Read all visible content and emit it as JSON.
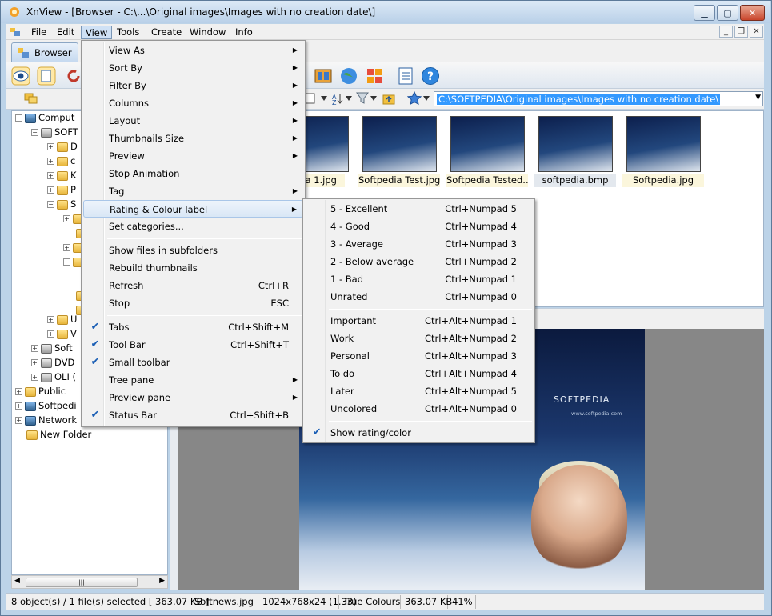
{
  "window": {
    "title": "XnView - [Browser - C:\\...\\Original images\\Images with no creation date\\]"
  },
  "menubar": [
    "File",
    "Edit",
    "View",
    "Tools",
    "Create",
    "Window",
    "Info"
  ],
  "tabs": {
    "browser": "Browser"
  },
  "address": {
    "path": "C:\\SOFTPEDIA\\Original images\\Images with no creation date\\"
  },
  "tree": [
    "Comput",
    "SOFT",
    "D",
    "c",
    "K",
    "P",
    "S",
    "U",
    "V",
    "Soft",
    "DVD",
    "OLI (",
    "Public",
    "Softpedi",
    "Network",
    "New Folder"
  ],
  "thumbnails": [
    "dia 1.jpg",
    "Softpedia Test.jpg",
    "Softpedia Tested....",
    "softpedia.bmp",
    "Softpedia.jpg"
  ],
  "poster": {
    "logo": "SOFTPEDIA",
    "url": "www.softpedia.com"
  },
  "view_menu": {
    "items": [
      {
        "label": "View As",
        "submenu": true
      },
      {
        "label": "Sort By",
        "submenu": true
      },
      {
        "label": "Filter By",
        "submenu": true
      },
      {
        "label": "Columns",
        "submenu": true
      },
      {
        "label": "Layout",
        "submenu": true
      },
      {
        "label": "Thumbnails Size",
        "submenu": true
      },
      {
        "label": "Preview",
        "submenu": true
      },
      {
        "label": "Stop Animation"
      },
      {
        "label": "Tag",
        "submenu": true
      },
      {
        "label": "Rating & Colour label",
        "submenu": true,
        "highlighted": true
      },
      {
        "label": "Set categories..."
      },
      {
        "label": "Show files in subfolders"
      },
      {
        "label": "Rebuild thumbnails"
      },
      {
        "label": "Refresh",
        "shortcut": "Ctrl+R"
      },
      {
        "label": "Stop",
        "shortcut": "ESC"
      },
      {
        "label": "Tabs",
        "shortcut": "Ctrl+Shift+M",
        "checked": true
      },
      {
        "label": "Tool Bar",
        "shortcut": "Ctrl+Shift+T",
        "checked": true
      },
      {
        "label": "Small toolbar",
        "checked": true
      },
      {
        "label": "Tree pane",
        "submenu": true
      },
      {
        "label": "Preview pane",
        "submenu": true
      },
      {
        "label": "Status Bar",
        "shortcut": "Ctrl+Shift+B",
        "checked": true
      }
    ]
  },
  "rating_menu": {
    "items": [
      {
        "label": "5 - Excellent",
        "shortcut": "Ctrl+Numpad 5"
      },
      {
        "label": "4 - Good",
        "shortcut": "Ctrl+Numpad 4"
      },
      {
        "label": "3 - Average",
        "shortcut": "Ctrl+Numpad 3"
      },
      {
        "label": "2 - Below average",
        "shortcut": "Ctrl+Numpad 2"
      },
      {
        "label": "1 - Bad",
        "shortcut": "Ctrl+Numpad 1"
      },
      {
        "label": "Unrated",
        "shortcut": "Ctrl+Numpad 0"
      },
      {
        "label": "Important",
        "shortcut": "Ctrl+Alt+Numpad 1"
      },
      {
        "label": "Work",
        "shortcut": "Ctrl+Alt+Numpad 2"
      },
      {
        "label": "Personal",
        "shortcut": "Ctrl+Alt+Numpad 3"
      },
      {
        "label": "To do",
        "shortcut": "Ctrl+Alt+Numpad 4"
      },
      {
        "label": "Later",
        "shortcut": "Ctrl+Alt+Numpad 5"
      },
      {
        "label": "Uncolored",
        "shortcut": "Ctrl+Alt+Numpad 0"
      },
      {
        "label": "Show rating/color",
        "checked": true
      }
    ]
  },
  "status": {
    "selection": "8 object(s) / 1 file(s) selected  [ 363.07 KB ]",
    "filename": "Softnews.jpg",
    "dimensions": "1024x768x24 (1.33)",
    "colours": "True Colours",
    "size": "363.07 KB",
    "zoom": "41%"
  },
  "colors": {
    "accent": "#3399ff",
    "menu_highlight": "#d9e7f6"
  }
}
